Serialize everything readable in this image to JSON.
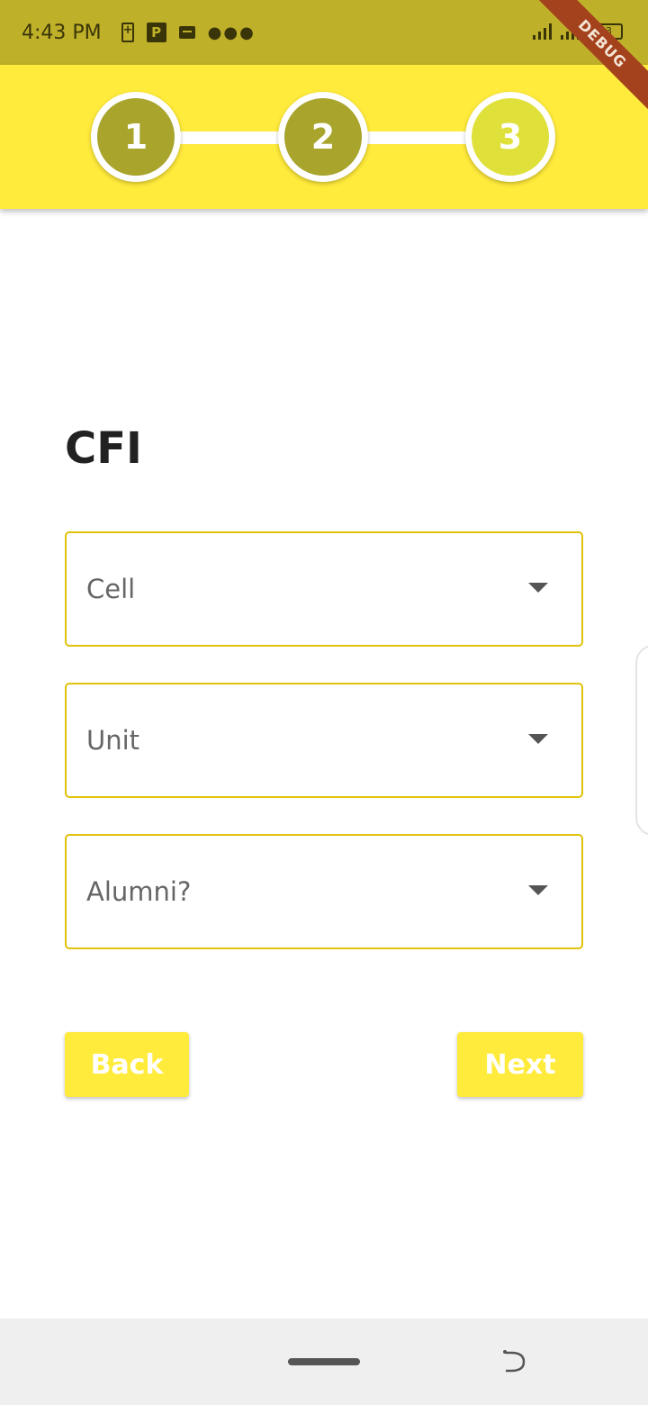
{
  "status_bar": {
    "time": "4:43 PM",
    "battery_level": "43",
    "icons": [
      "battery-saver-icon",
      "publisher-icon",
      "message-icon",
      "more-dots-icon",
      "signal-icon",
      "signal-icon",
      "battery-icon"
    ]
  },
  "debug_banner": "DEBUG",
  "stepper": {
    "steps": [
      {
        "label": "1",
        "state": "complete"
      },
      {
        "label": "2",
        "state": "complete"
      },
      {
        "label": "3",
        "state": "active"
      }
    ]
  },
  "form": {
    "title": "CFI",
    "fields": [
      {
        "label": "Cell"
      },
      {
        "label": "Unit"
      },
      {
        "label": "Alumni?"
      }
    ]
  },
  "buttons": {
    "back": "Back",
    "next": "Next"
  },
  "colors": {
    "accent": "#ffeb3b",
    "status_bar": "#bfb02a",
    "step_complete": "#a8a42c",
    "step_active": "#dfe03a",
    "field_border": "#e2c20a"
  }
}
